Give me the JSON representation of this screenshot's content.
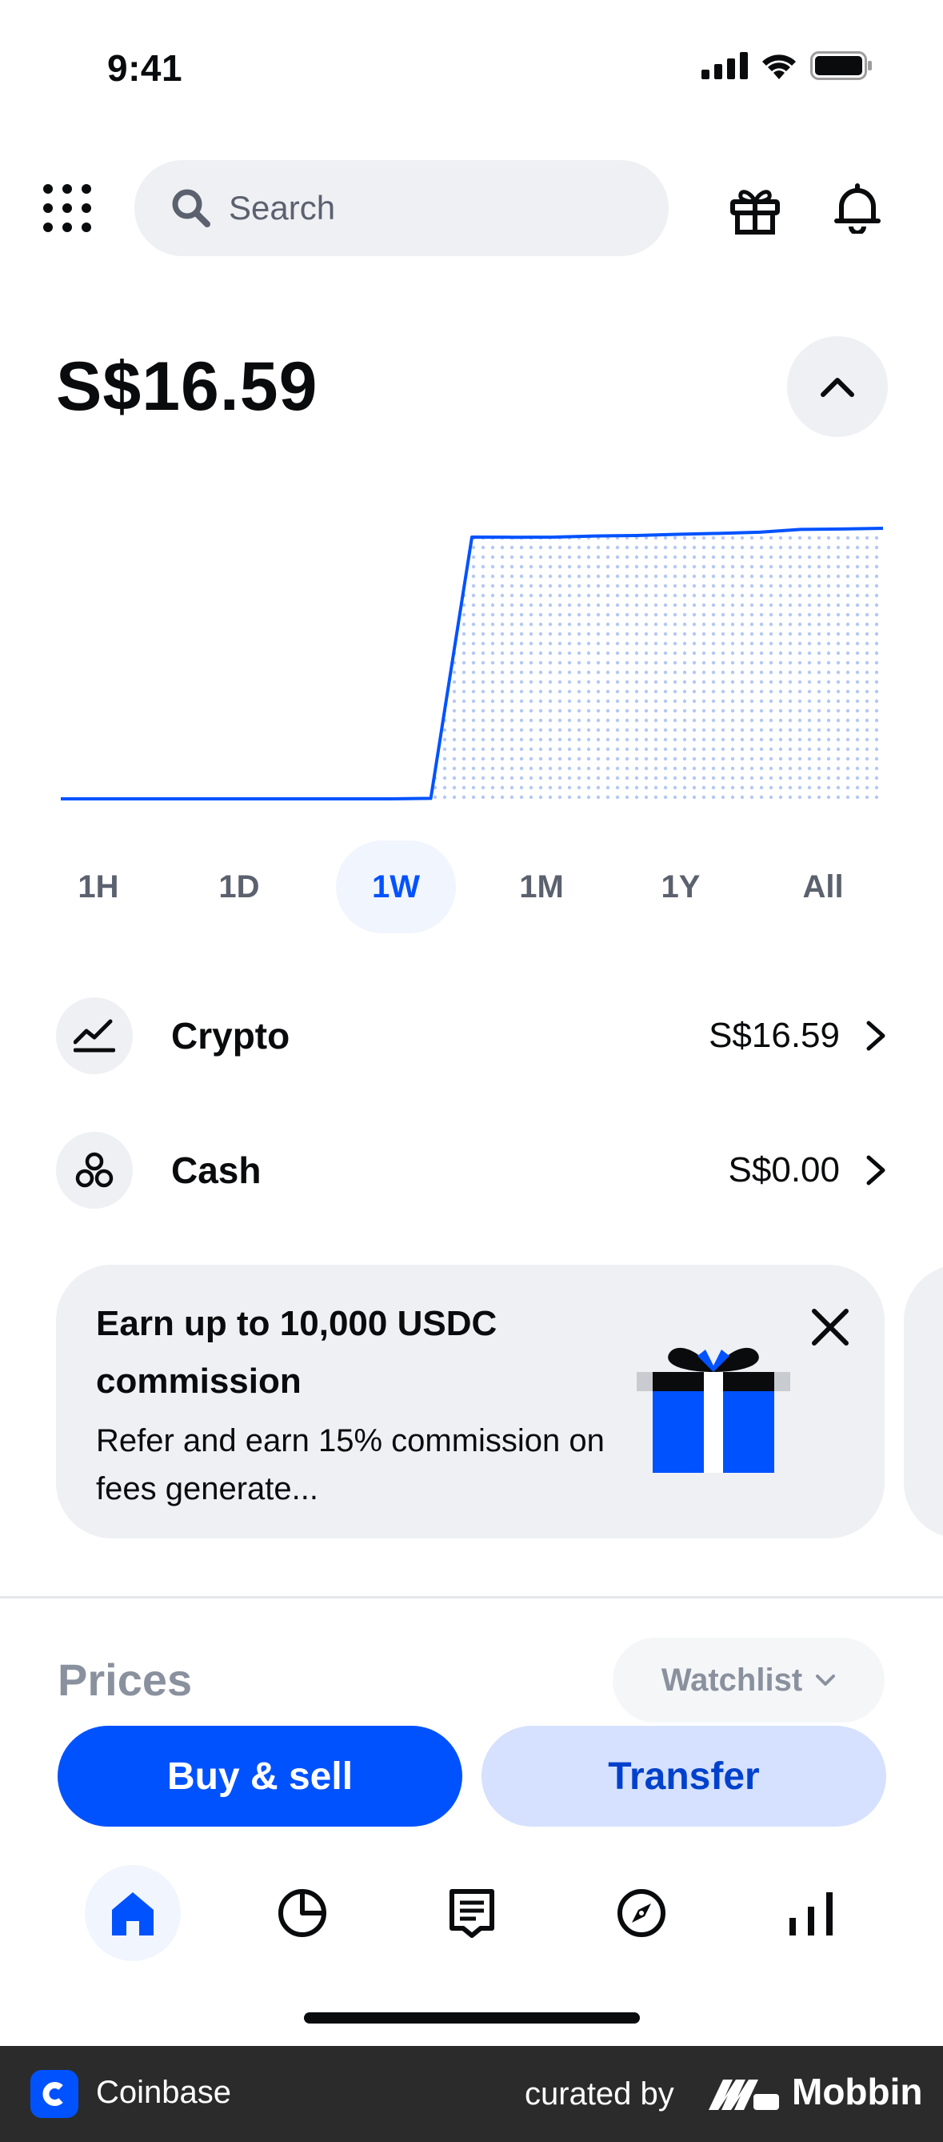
{
  "status_bar": {
    "time": "9:41"
  },
  "header": {
    "search_placeholder": "Search"
  },
  "balance": {
    "amount": "S$16.59"
  },
  "chart_data": {
    "type": "area",
    "x": [
      0,
      1,
      2,
      3,
      4,
      5,
      6,
      7,
      8,
      9,
      10,
      11,
      12,
      13,
      14,
      15,
      16,
      17,
      18,
      19,
      20
    ],
    "values": [
      0,
      0,
      0,
      0,
      0,
      0,
      0,
      0,
      0,
      0.03,
      16.05,
      16.04,
      16.05,
      16.12,
      16.15,
      16.22,
      16.28,
      16.35,
      16.52,
      16.55,
      16.59
    ],
    "grid": false,
    "line_color": "#0052ff"
  },
  "range_tabs": [
    {
      "label": "1H",
      "active": false
    },
    {
      "label": "1D",
      "active": false
    },
    {
      "label": "1W",
      "active": true
    },
    {
      "label": "1M",
      "active": false
    },
    {
      "label": "1Y",
      "active": false
    },
    {
      "label": "All",
      "active": false
    }
  ],
  "assets": {
    "crypto": {
      "name": "Crypto",
      "value": "S$16.59",
      "icon": "chart-line-icon"
    },
    "cash": {
      "name": "Cash",
      "value": "S$0.00",
      "icon": "coins-icon"
    }
  },
  "promo": {
    "title": "Earn up to 10,000 USDC commission",
    "body": "Refer and earn 15% commission on fees generate...",
    "icon": "gift-box-icon"
  },
  "prices": {
    "title": "Prices",
    "filter": "Watchlist"
  },
  "actions": {
    "primary": "Buy & sell",
    "secondary": "Transfer"
  },
  "bottom_nav": [
    {
      "icon": "home-icon",
      "active": true
    },
    {
      "icon": "portfolio-pie-icon",
      "active": false
    },
    {
      "icon": "transactions-receipt-icon",
      "active": false
    },
    {
      "icon": "explore-compass-icon",
      "active": false
    },
    {
      "icon": "markets-bars-icon",
      "active": false
    }
  ],
  "footer": {
    "app_name": "Coinbase",
    "curated_by": "curated by",
    "brand": "Mobbin"
  },
  "colors": {
    "accent": "#0052ff",
    "accent_light": "#d5e1fe",
    "surface": "#eef0f3",
    "text_primary": "#0a0b0d",
    "text_secondary": "#5b616e",
    "footer_bg": "#2b2b2b"
  }
}
